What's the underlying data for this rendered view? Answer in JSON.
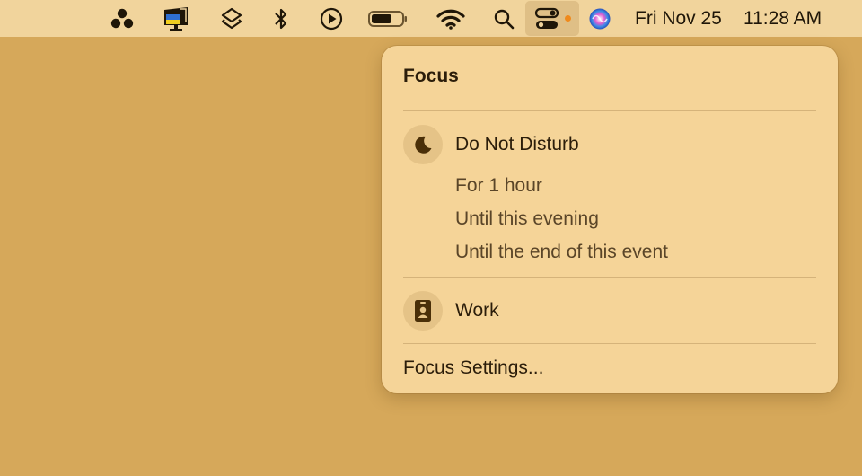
{
  "menubar": {
    "icons": [
      "flower-app-icon",
      "monitor-flag-icon",
      "layers-icon",
      "bluetooth-icon",
      "play-circle-icon",
      "battery-icon",
      "wifi-icon",
      "search-icon",
      "control-center-icon",
      "siri-icon"
    ],
    "date": "Fri Nov 25",
    "time": "11:28 AM",
    "indicator_color": "#f08a1c"
  },
  "focus_panel": {
    "title": "Focus",
    "modes": [
      {
        "label": "Do Not Disturb",
        "icon": "moon-icon",
        "options": [
          "For 1 hour",
          "Until this evening",
          "Until the end of this event"
        ]
      },
      {
        "label": "Work",
        "icon": "id-badge-icon"
      }
    ],
    "settings_label": "Focus Settings..."
  }
}
